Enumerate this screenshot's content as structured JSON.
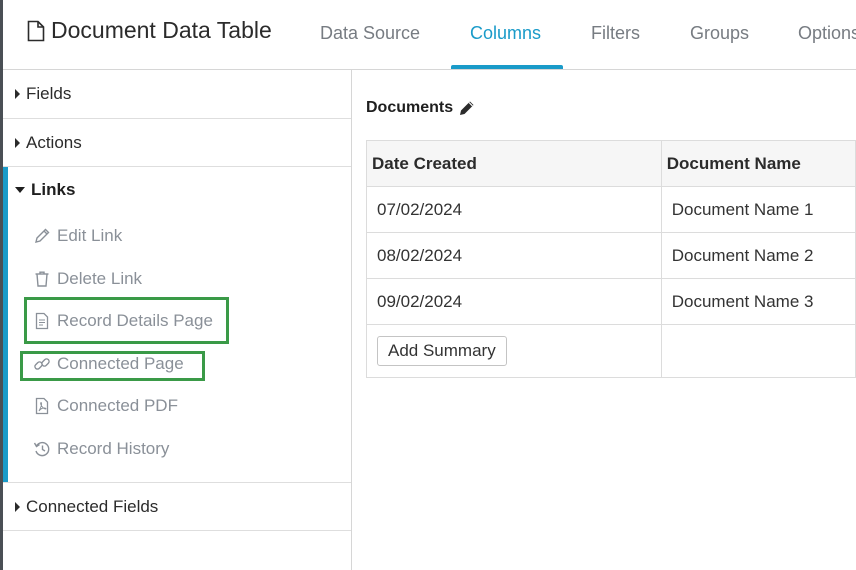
{
  "header": {
    "title": "Document Data Table",
    "tabs": [
      "Data Source",
      "Columns",
      "Filters",
      "Groups",
      "Options"
    ],
    "active_tab": "Columns"
  },
  "sidebar": {
    "sections": {
      "fields": "Fields",
      "actions": "Actions",
      "links": "Links",
      "connected_fields": "Connected Fields"
    },
    "link_items": [
      {
        "label": "Edit Link",
        "icon": "pencil-icon"
      },
      {
        "label": "Delete Link",
        "icon": "trash-icon"
      },
      {
        "label": "Record Details Page",
        "icon": "document-icon"
      },
      {
        "label": "Connected Page",
        "icon": "link-icon"
      },
      {
        "label": "Connected PDF",
        "icon": "pdf-icon"
      },
      {
        "label": "Record History",
        "icon": "history-icon"
      }
    ]
  },
  "main": {
    "table_title": "Documents",
    "columns": [
      "Date Created",
      "Document Name"
    ],
    "rows": [
      [
        "07/02/2024",
        "Document Name 1"
      ],
      [
        "08/02/2024",
        "Document Name 2"
      ],
      [
        "09/02/2024",
        "Document Name 3"
      ]
    ],
    "add_summary_label": "Add Summary"
  },
  "colors": {
    "accent": "#1a9bc9",
    "highlight": "#3a9a47",
    "muted_text": "#8a9098"
  }
}
